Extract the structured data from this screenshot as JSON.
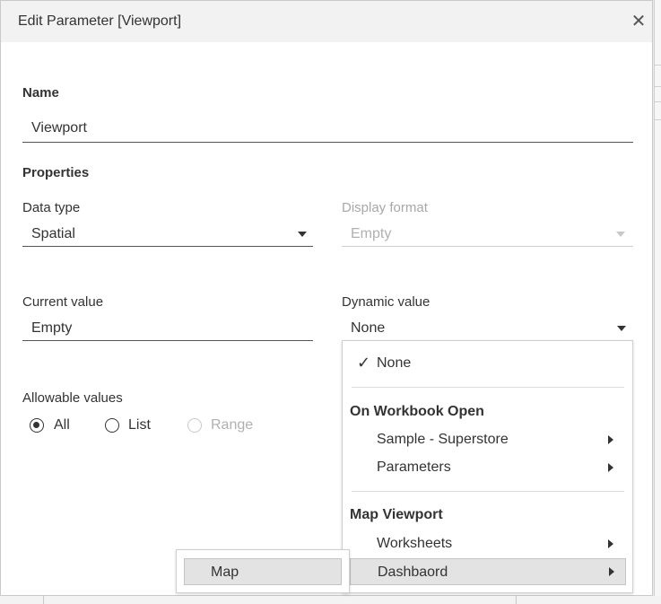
{
  "dialog": {
    "title": "Edit Parameter [Viewport]",
    "close_glyph": "✕"
  },
  "name": {
    "label": "Name",
    "value": "Viewport"
  },
  "properties": {
    "label": "Properties",
    "data_type": {
      "label": "Data type",
      "value": "Spatial"
    },
    "display_format": {
      "label": "Display format",
      "value": "Empty",
      "enabled": false
    }
  },
  "current_value": {
    "label": "Current value",
    "value": "Empty"
  },
  "dynamic_value": {
    "label": "Dynamic value",
    "value": "None"
  },
  "allowable_values": {
    "label": "Allowable values",
    "options": [
      {
        "label": "All",
        "checked": true,
        "enabled": true
      },
      {
        "label": "List",
        "checked": false,
        "enabled": true
      },
      {
        "label": "Range",
        "checked": false,
        "enabled": false
      }
    ]
  },
  "dropdown_menu": {
    "none_item": {
      "label": "None",
      "checked": true,
      "check_glyph": "✓"
    },
    "section1": {
      "header": "On Workbook Open",
      "items": [
        {
          "label": "Sample - Superstore",
          "has_submenu": true
        },
        {
          "label": "Parameters",
          "has_submenu": true
        }
      ]
    },
    "section2": {
      "header": "Map Viewport",
      "items": [
        {
          "label": "Worksheets",
          "has_submenu": true
        },
        {
          "label": "Dashbaord",
          "has_submenu": true,
          "highlighted": true
        }
      ]
    }
  },
  "submenu": {
    "items": [
      {
        "label": "Map",
        "highlighted": true
      }
    ]
  },
  "colors": {
    "titlebar_bg": "#f2f2f2",
    "highlight_bg": "#e3e3e3",
    "text": "#333333",
    "disabled_text": "#a8a8a8"
  }
}
